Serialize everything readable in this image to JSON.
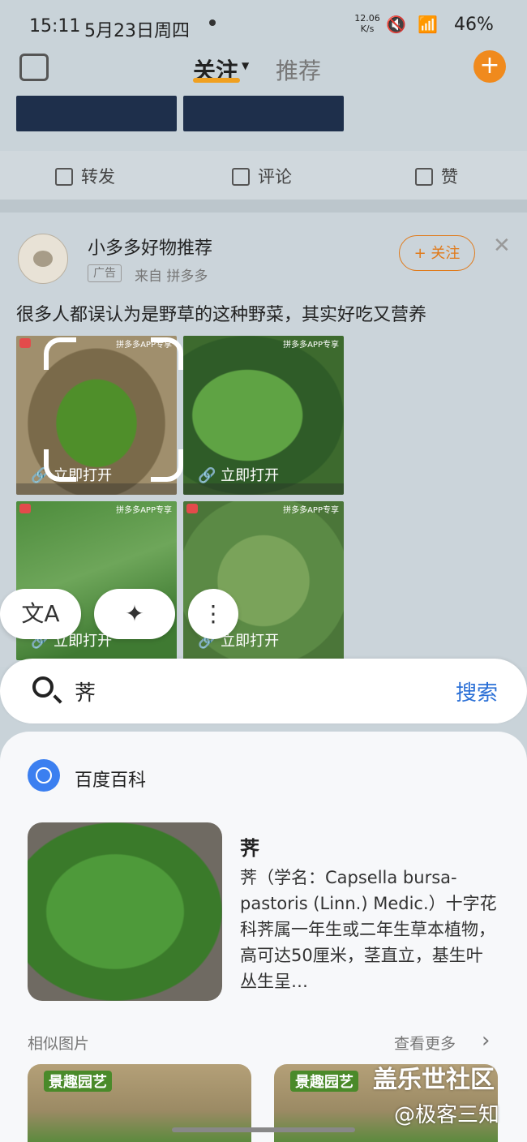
{
  "status": {
    "time": "15:11",
    "date": "5月23日周四",
    "net_speed": "12.06 K/s",
    "battery": "46%"
  },
  "nav": {
    "tab_follow": "关注",
    "tab_recommend": "推荐",
    "accent": "#f0a020"
  },
  "actions": {
    "repost": "转发",
    "comment": "评论",
    "like": "赞"
  },
  "ad": {
    "name": "小多多好物推荐",
    "tag": "广告",
    "source": "来自 拼多多",
    "follow": "+ 关注",
    "headline": "很多人都误认为是野草的这种野菜，其实好吃又营养",
    "images": [
      {
        "tag": "拼多多APP专享",
        "open": "立即打开"
      },
      {
        "tag": "拼多多APP专享",
        "open": "立即打开"
      },
      {
        "tag": "拼多多APP专享",
        "open": "立即打开"
      },
      {
        "tag": "拼多多APP专享",
        "open": "立即打开"
      }
    ]
  },
  "search": {
    "query": "荠",
    "button": "搜索",
    "accent": "#2a6fd6"
  },
  "result": {
    "source": "百度百科",
    "title": "荠",
    "description": "荠（学名：Capsella bursa-pastoris (Linn.) Medic.）十字花科荠属一年生或二年生草本植物，高可达50厘米，茎直立，基生叶丛生呈…",
    "similar_label": "相似图片",
    "more_label": "查看更多",
    "similar_logo": "景趣园艺"
  },
  "watermark": {
    "line1": "盖乐世社区",
    "line2": "@极客三知"
  }
}
